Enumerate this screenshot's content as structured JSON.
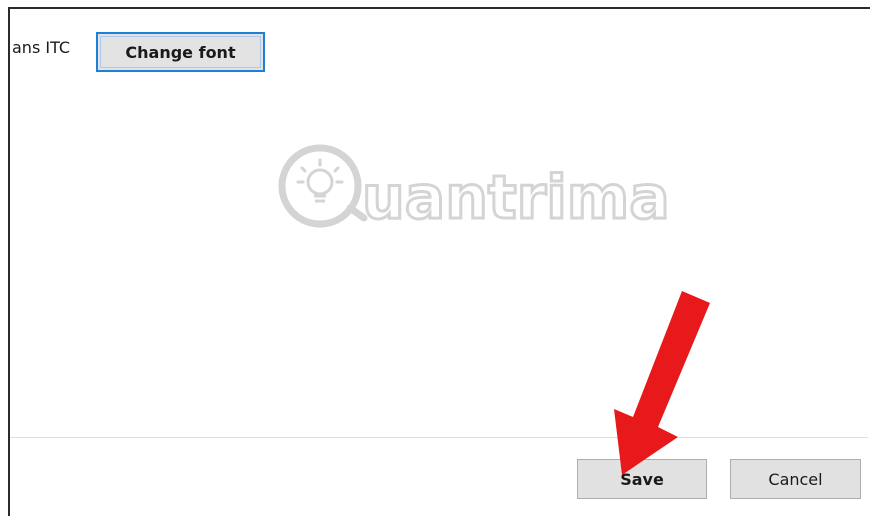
{
  "font_section": {
    "font_name": "ans ITC",
    "change_font_label": "Change font"
  },
  "watermark": {
    "text": "uantrimang",
    "icon": "lightbulb-icon"
  },
  "footer": {
    "save_label": "Save",
    "cancel_label": "Cancel"
  },
  "annotation": {
    "icon": "red-arrow-icon",
    "color": "#e8191a"
  },
  "colors": {
    "focus_border": "#1e7fd6",
    "button_bg": "#e1e1e1"
  }
}
